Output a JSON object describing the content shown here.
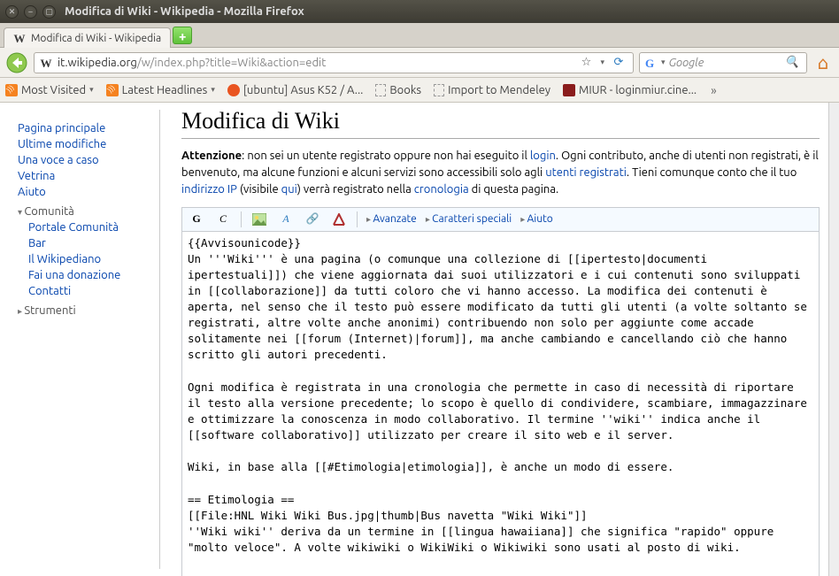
{
  "window": {
    "title": "Modifica di Wiki - Wikipedia - Mozilla Firefox"
  },
  "tab": {
    "label": "Modifica di Wiki - Wikipedia",
    "favicon_letter": "W"
  },
  "url": {
    "favicon_letter": "W",
    "host": "it.wikipedia.org",
    "path": "/w/index.php?title=Wiki&action=edit"
  },
  "search": {
    "engine": "Google",
    "placeholder": "Google"
  },
  "bookmarks": {
    "most_visited": "Most Visited",
    "latest_headlines": "Latest Headlines",
    "ubuntu_asus": "[ubuntu] Asus K52 / A...",
    "books": "Books",
    "mendeley": "Import to Mendeley",
    "miur": "MIUR - loginmiur.cine..."
  },
  "sidebar": {
    "main": "Pagina principale",
    "recent": "Ultime modifiche",
    "random": "Una voce a caso",
    "vetrina": "Vetrina",
    "help": "Aiuto",
    "community_head": "Comunità",
    "community": {
      "portal": "Portale Comunità",
      "bar": "Bar",
      "wikipediano": "Il Wikipediano",
      "donate": "Fai una donazione",
      "contacts": "Contatti"
    },
    "tools_head": "Strumenti"
  },
  "page": {
    "title": "Modifica di Wiki",
    "notice": {
      "bold": "Attenzione",
      "t1": ": non sei un utente registrato oppure non hai eseguito il ",
      "login": "login",
      "t2": ". Ogni contributo, anche di utenti non registrati, è il benvenuto, ma alcune funzioni e alcuni servizi sono accessibili solo agli ",
      "reg_users": "utenti registrati",
      "t3": ". Tieni comunque conto che il tuo ",
      "ip": "indirizzo IP",
      "t4": " (visibile ",
      "here": "qui",
      "t5": ") verrà registrato nella ",
      "history": "cronologia",
      "t6": " di questa pagina."
    }
  },
  "toolbar": {
    "bold": "G",
    "italic": "C",
    "advanced": "Avanzate",
    "special": "Caratteri speciali",
    "help": "Aiuto"
  },
  "editor_text": "{{Avvisounicode}}\nUn '''Wiki''' è una pagina (o comunque una collezione di [[ipertesto|documenti ipertestuali]]) che viene aggiornata dai suoi utilizzatori e i cui contenuti sono sviluppati in [[collaborazione]] da tutti coloro che vi hanno accesso. La modifica dei contenuti è aperta, nel senso che il testo può essere modificato da tutti gli utenti (a volte soltanto se registrati, altre volte anche anonimi) contribuendo non solo per aggiunte come accade solitamente nei [[forum (Internet)|forum]], ma anche cambiando e cancellando ciò che hanno scritto gli autori precedenti.\n\nOgni modifica è registrata in una cronologia che permette in caso di necessità di riportare il testo alla versione precedente; lo scopo è quello di condividere, scambiare, immagazzinare e ottimizzare la conoscenza in modo collaborativo. Il termine ''wiki'' indica anche il [[software collaborativo]] utilizzato per creare il sito web e il server.\n\nWiki, in base alla [[#Etimologia|etimologia]], è anche un modo di essere.\n\n== Etimologia ==\n[[File:HNL Wiki Wiki Bus.jpg|thumb|Bus navetta \"Wiki Wiki\"]]\n''Wiki wiki'' deriva da un termine in [[lingua hawaiiana]] che significa \"rapido\" oppure \"molto veloce\". A volte wikiwiki o WikiWiki o Wikiwiki sono usati al posto di wiki."
}
